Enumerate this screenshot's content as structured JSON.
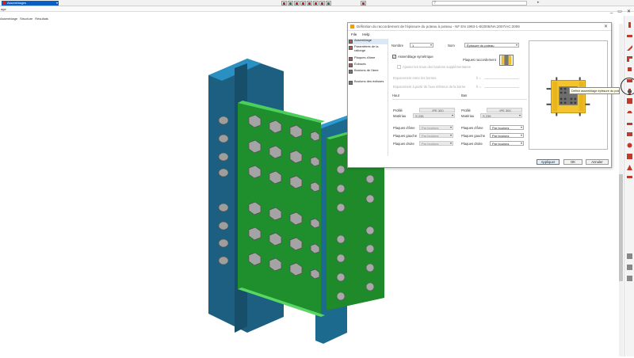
{
  "toolbar": {
    "combo_value": "Assemblages",
    "search_icon_text": "?"
  },
  "menubar": {
    "item1": "age"
  },
  "tabs": [
    "Assemblage",
    "Structure",
    "Résultats"
  ],
  "window_controls": [
    "_",
    "▭",
    "✕"
  ],
  "dialog": {
    "title": "Définition du raccordement de l'épissure du poteau à poteau - NF EN 1993-1-8/2005/NA:2007/AC:2009",
    "menu": [
      "File",
      "Help"
    ],
    "side_items": [
      {
        "label": "Assemblage"
      },
      {
        "label": "Paramètres de la rallonge",
        "tall": true
      },
      {
        "label": "Plaques d'âme"
      },
      {
        "label": "Éclisses"
      },
      {
        "label": "Boulons de l'âme"
      },
      {
        "label": "Boulons des éclisses"
      }
    ],
    "nombre_label": "Nombre",
    "nombre_value": "1",
    "nom_label": "Nom",
    "nom_value": "Épissure du poteau",
    "symetrique_label": "Assemblage symétrique",
    "disabled_opt_label": "Ajouter les trous des boulons supplémentaires",
    "thumb_label": "Plaques raccordement",
    "esp_bornes_label": "Espacement entre les bornes",
    "esp_bornes_unit": "h =",
    "esp_partir_label": "Espacement à partir de l'axe inférieur de la borne",
    "esp_partir_unit": "h =",
    "haut_label": "Haut",
    "bas_label": "Bas",
    "profil_label": "Profilé",
    "materiau_label": "Matériau",
    "haut_profil": "IPE 300",
    "haut_materiau": "S 235",
    "bas_profil": "IPE 300",
    "bas_materiau": "S 235",
    "plaques_ame_label": "Plaques d'âme",
    "plaques_gauche_label": "Plaques gauche",
    "plaques_droite_label": "Plaques droite",
    "haut_ame_value": "Par boulons",
    "haut_gauche_value": "Par boulons",
    "haut_droite_value": "Par boulons",
    "bas_ame_value": "Par boulons",
    "bas_gauche_value": "Par boulons",
    "bas_droite_value": "Par boulons",
    "btn_appliquer": "Appliquer",
    "btn_ok": "OK",
    "btn_annuler": "Annuler",
    "check_mark": "✓",
    "close_glyph": "✕",
    "dropdown_glyph": "▾"
  },
  "tooltip": {
    "text": "Définir assemblage épissure du poteau"
  },
  "colors": {
    "column_blue": "#1d6a8f",
    "plate_green": "#1f8a2a",
    "bolt_gray": "#a9a9a9",
    "accent_blue": "#0a5ec2"
  },
  "icons": [
    "search-icon",
    "close-icon",
    "dropdown-icon",
    "checkbox-icon",
    "app-icon"
  ]
}
